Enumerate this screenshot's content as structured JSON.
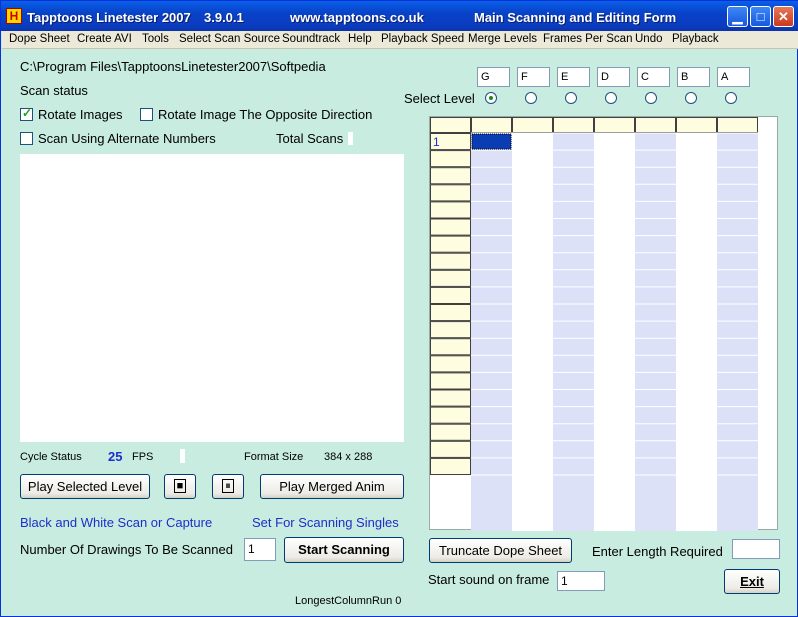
{
  "title": {
    "app": "Tapptoons Linetester 2007",
    "version": "3.9.0.1",
    "url": "www.tapptoons.co.uk",
    "form": "Main Scanning and Editing Form",
    "icon_letter": "H"
  },
  "menu": [
    "Dope Sheet",
    "Create AVI",
    "Tools",
    "Select Scan Source",
    "Soundtrack",
    "Help",
    "Playback Speed",
    "Merge Levels",
    "Frames Per Scan",
    "Undo",
    "Playback"
  ],
  "path": "C:\\Program Files\\TapptoonsLinetester2007\\Softpedia",
  "scan_status": "Scan status",
  "options": {
    "rotate_images": {
      "label": "Rotate Images",
      "checked": true
    },
    "rotate_opposite": {
      "label": "Rotate Image The Opposite Direction",
      "checked": false
    },
    "alternate_numbers": {
      "label": "Scan Using Alternate Numbers",
      "checked": false
    }
  },
  "total_scans_label": "Total Scans",
  "cycle_status_label": "Cycle Status",
  "fps_value": "25",
  "fps_label": "FPS",
  "format_size_label": "Format Size",
  "format_size_value": "384 x 288",
  "buttons": {
    "play_selected": "Play Selected Level",
    "stop_symbol": "■",
    "pause_symbol": "⏸",
    "play_merged": "Play Merged Anim",
    "start_scanning": "Start Scanning",
    "truncate": "Truncate Dope Sheet",
    "exit": "Exit"
  },
  "links": {
    "bw_scan": "Black and White Scan or Capture",
    "singles": "Set For Scanning Singles"
  },
  "drawings_label": "Number Of Drawings To Be Scanned",
  "drawings_value": "1",
  "longest_column": "LongestColumnRun 0",
  "select_level_label": "Select Level",
  "levels": [
    "G",
    "F",
    "E",
    "D",
    "C",
    "B",
    "A"
  ],
  "selected_level_index": 0,
  "dope_sheet": {
    "first_row_label": "1",
    "visible_rows": 20
  },
  "enter_length_label": "Enter Length Required",
  "enter_length_value": "",
  "start_sound_label": "Start sound on frame",
  "start_sound_value": "1",
  "colors": {
    "background": "#c8ecdf",
    "grid_header": "#fffde0",
    "grid_alt": "#dde1f7",
    "link": "#1d2ecb"
  }
}
